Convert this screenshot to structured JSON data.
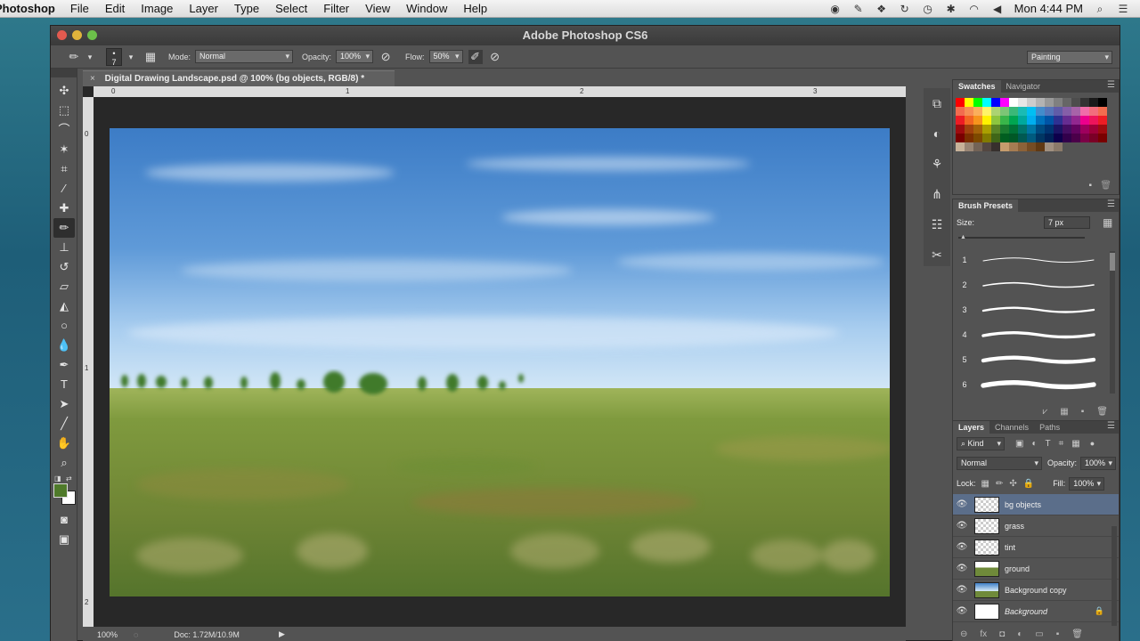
{
  "menubar": {
    "app_name": "Photoshop",
    "items": [
      "File",
      "Edit",
      "Image",
      "Layer",
      "Type",
      "Select",
      "Filter",
      "View",
      "Window",
      "Help"
    ],
    "clock": "Mon 4:44 PM"
  },
  "window": {
    "title": "Adobe Photoshop CS6"
  },
  "options_bar": {
    "brush_size": "7",
    "mode_label": "Mode:",
    "mode_value": "Normal",
    "opacity_label": "Opacity:",
    "opacity_value": "100%",
    "flow_label": "Flow:",
    "flow_value": "50%",
    "workspace": "Painting"
  },
  "document": {
    "tab_title": "Digital Drawing Landscape.psd @ 100% (bg objects, RGB/8) *",
    "ruler_top": [
      "0",
      "1",
      "2",
      "3"
    ],
    "ruler_left": [
      "0",
      "1",
      "2"
    ]
  },
  "status": {
    "zoom": "100%",
    "doc_size": "Doc: 1.72M/10.9M"
  },
  "swatches_panel": {
    "tabs": [
      "Swatches",
      "Navigator"
    ]
  },
  "brush_presets": {
    "title": "Brush Presets",
    "size_label": "Size:",
    "size_value": "7 px",
    "numbers": [
      "1",
      "2",
      "3",
      "4",
      "5",
      "6"
    ]
  },
  "layers_panel": {
    "tabs": [
      "Layers",
      "Channels",
      "Paths"
    ],
    "filter": "Kind",
    "blend_mode": "Normal",
    "opacity_label": "Opacity:",
    "opacity_value": "100%",
    "lock_label": "Lock:",
    "fill_label": "Fill:",
    "fill_value": "100%",
    "layers": [
      {
        "name": "bg objects",
        "selected": true
      },
      {
        "name": "grass"
      },
      {
        "name": "tint"
      },
      {
        "name": "ground"
      },
      {
        "name": "Background copy"
      },
      {
        "name": "Background",
        "locked": true
      }
    ]
  },
  "colors": {
    "foreground": "#4f7a2a",
    "background": "#ffffff",
    "sky_top": "#3f80c8",
    "sky_horizon": "#cfe4f6",
    "field": "#6f8a3a"
  }
}
